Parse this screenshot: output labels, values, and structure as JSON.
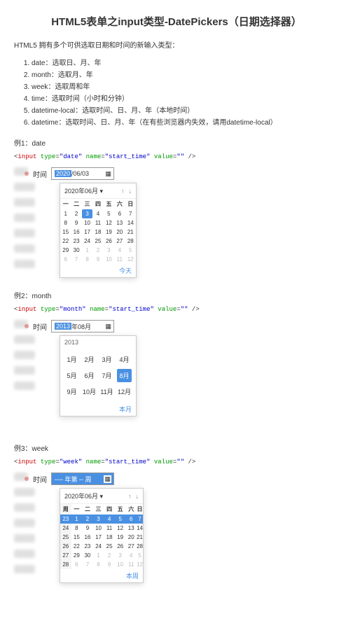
{
  "title": "HTML5表单之input类型-DatePickers（日期选择器）",
  "intro": "HTML5 拥有多个可供选取日期和时间的新输入类型：",
  "types": [
    "date：选取日、月、年",
    "month：选取月、年",
    "week：选取周和年",
    "time：选取时间（小时和分钟）",
    "datetime-local：选取时间、日、月、年（本地时间）",
    "datetime：选取时间、日、月、年（在有些浏览器内失效，请用datetime-local）"
  ],
  "ex1": {
    "label": "例1：date",
    "code": {
      "tag": "input",
      "attrs": [
        [
          "type",
          "date"
        ],
        [
          "name",
          "start_time"
        ],
        [
          "value",
          ""
        ]
      ]
    },
    "field_label": "时间",
    "input_sel": "2020",
    "input_rest": "/06/03",
    "picker_title": "2020年06月 ▾",
    "dow": [
      "一",
      "二",
      "三",
      "四",
      "五",
      "六",
      "日"
    ],
    "weeks": [
      [
        "1",
        "2",
        "3",
        "4",
        "5",
        "6",
        "7"
      ],
      [
        "8",
        "9",
        "10",
        "11",
        "12",
        "13",
        "14"
      ],
      [
        "15",
        "16",
        "17",
        "18",
        "19",
        "20",
        "21"
      ],
      [
        "22",
        "23",
        "24",
        "25",
        "26",
        "27",
        "28"
      ],
      [
        "29",
        "30",
        "1",
        "2",
        "3",
        "4",
        "5"
      ],
      [
        "6",
        "7",
        "8",
        "9",
        "10",
        "11",
        "12"
      ]
    ],
    "today": "今天"
  },
  "ex2": {
    "label": "例2：month",
    "code": {
      "tag": "input",
      "attrs": [
        [
          "type",
          "month"
        ],
        [
          "name",
          "start_time"
        ],
        [
          "value",
          ""
        ]
      ]
    },
    "field_label": "时间",
    "input_sel": "2013",
    "input_rest": "年08月",
    "year": "2013",
    "months": [
      "1月",
      "2月",
      "3月",
      "4月",
      "5月",
      "6月",
      "7月",
      "8月",
      "9月",
      "10月",
      "11月",
      "12月"
    ],
    "sel_month_idx": 7,
    "today": "本月"
  },
  "ex3": {
    "label": "例3：week",
    "code": {
      "tag": "input",
      "attrs": [
        [
          "type",
          "week"
        ],
        [
          "name",
          "start_time"
        ],
        [
          "value",
          ""
        ]
      ]
    },
    "field_label": "时间",
    "input_placeholder": "---- 年第 -- 周",
    "picker_title": "2020年06月 ▾",
    "dow": [
      "周",
      "一",
      "二",
      "三",
      "四",
      "五",
      "六",
      "日"
    ],
    "weeks": [
      [
        "23",
        "1",
        "2",
        "3",
        "4",
        "5",
        "6",
        "7"
      ],
      [
        "24",
        "8",
        "9",
        "10",
        "11",
        "12",
        "13",
        "14"
      ],
      [
        "25",
        "15",
        "16",
        "17",
        "18",
        "19",
        "20",
        "21"
      ],
      [
        "26",
        "22",
        "23",
        "24",
        "25",
        "26",
        "27",
        "28"
      ],
      [
        "27",
        "29",
        "30",
        "1",
        "2",
        "3",
        "4",
        "5"
      ],
      [
        "28",
        "6",
        "7",
        "8",
        "9",
        "10",
        "11",
        "12"
      ]
    ],
    "today": "本周"
  }
}
